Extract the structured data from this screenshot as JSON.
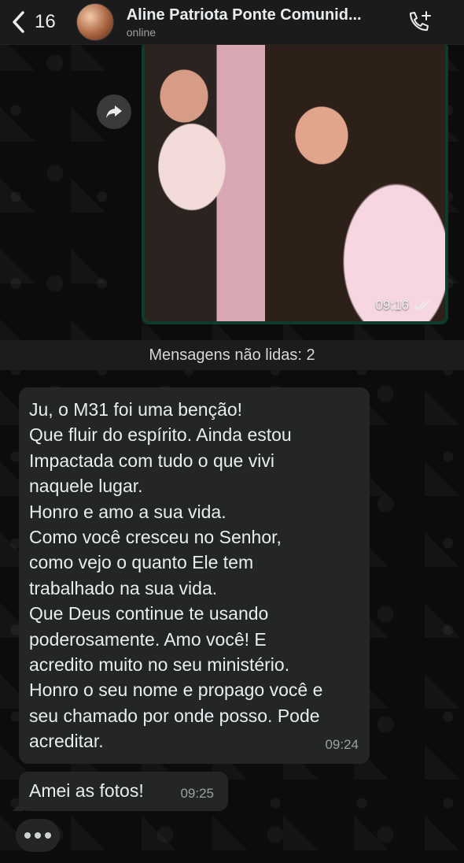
{
  "header": {
    "back_count": "16",
    "title": "Aline Patriota Ponte Comunid...",
    "status": "online"
  },
  "image_message": {
    "time": "09:16"
  },
  "unread_divider": "Mensagens não lidas: 2",
  "messages": [
    {
      "lines": [
        "Ju, o M31 foi uma benção!",
        "Que fluir do espírito. Ainda estou",
        "Impactada com tudo o que vivi",
        "naquele lugar.",
        "Honro e amo a sua vida.",
        "Como você cresceu no Senhor,",
        "como vejo o quanto Ele tem",
        "trabalhado na sua vida.",
        "Que Deus continue te usando",
        "poderosamente. Amo você! E",
        "acredito muito no seu ministério.",
        "Honro o seu nome e propago você e",
        "seu chamado por onde posso. Pode",
        "acreditar."
      ],
      "time": "09:24"
    },
    {
      "text": "Amei as fotos!",
      "time": "09:25"
    }
  ],
  "icons": {
    "back": "chevron-left-icon",
    "call": "add-call-icon",
    "forward": "forward-icon",
    "read_receipt": "double-check-icon",
    "typing": "typing-dots-icon"
  },
  "colors": {
    "header_bg": "#1b1b1b",
    "bubble_bg": "#242626",
    "image_bubble_border": "#0f3b2c",
    "text": "#e9edef",
    "meta_text": "#9aa0a3"
  }
}
